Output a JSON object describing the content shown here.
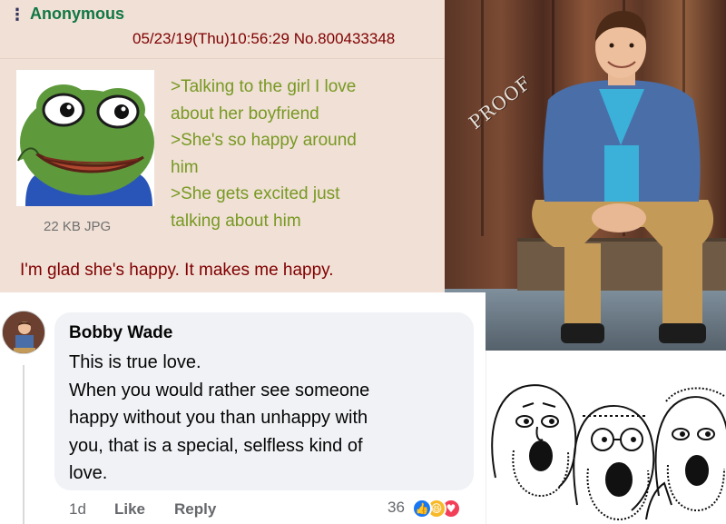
{
  "chan_post": {
    "menu_icon": "vertical-dots-icon",
    "poster_name": "Anonymous",
    "datetime": "05/23/19(Thu)10:56:29",
    "post_number": "No.800433348",
    "file_size": "22 KB JPG",
    "greentext_lines": [
      ">Talking to the girl I love",
      "about her boyfriend",
      ">She's so happy around",
      "him",
      ">She gets excited just",
      "talking about him"
    ],
    "closing_line": "I'm glad she's happy. It makes me happy.",
    "colors": {
      "name": "#117743",
      "meta": "#800000",
      "greentext": "#789922",
      "background": "#f0e0d6"
    }
  },
  "photo": {
    "stamp_text": "PROOF"
  },
  "fb_comment": {
    "author": "Bobby Wade",
    "text_lines": [
      "This is true love.",
      "When you would rather see someone",
      "happy without you than unhappy with",
      "you, that is a special, selfless kind of",
      "love."
    ],
    "time": "1d",
    "like_label": "Like",
    "reply_label": "Reply",
    "reaction_count": "36",
    "reactions": [
      {
        "icon": "thumbs-up-icon",
        "color": "#1877f2"
      },
      {
        "icon": "haha-face-icon",
        "color": "#f7b928"
      },
      {
        "icon": "heart-icon",
        "color": "#f33e58"
      }
    ]
  }
}
